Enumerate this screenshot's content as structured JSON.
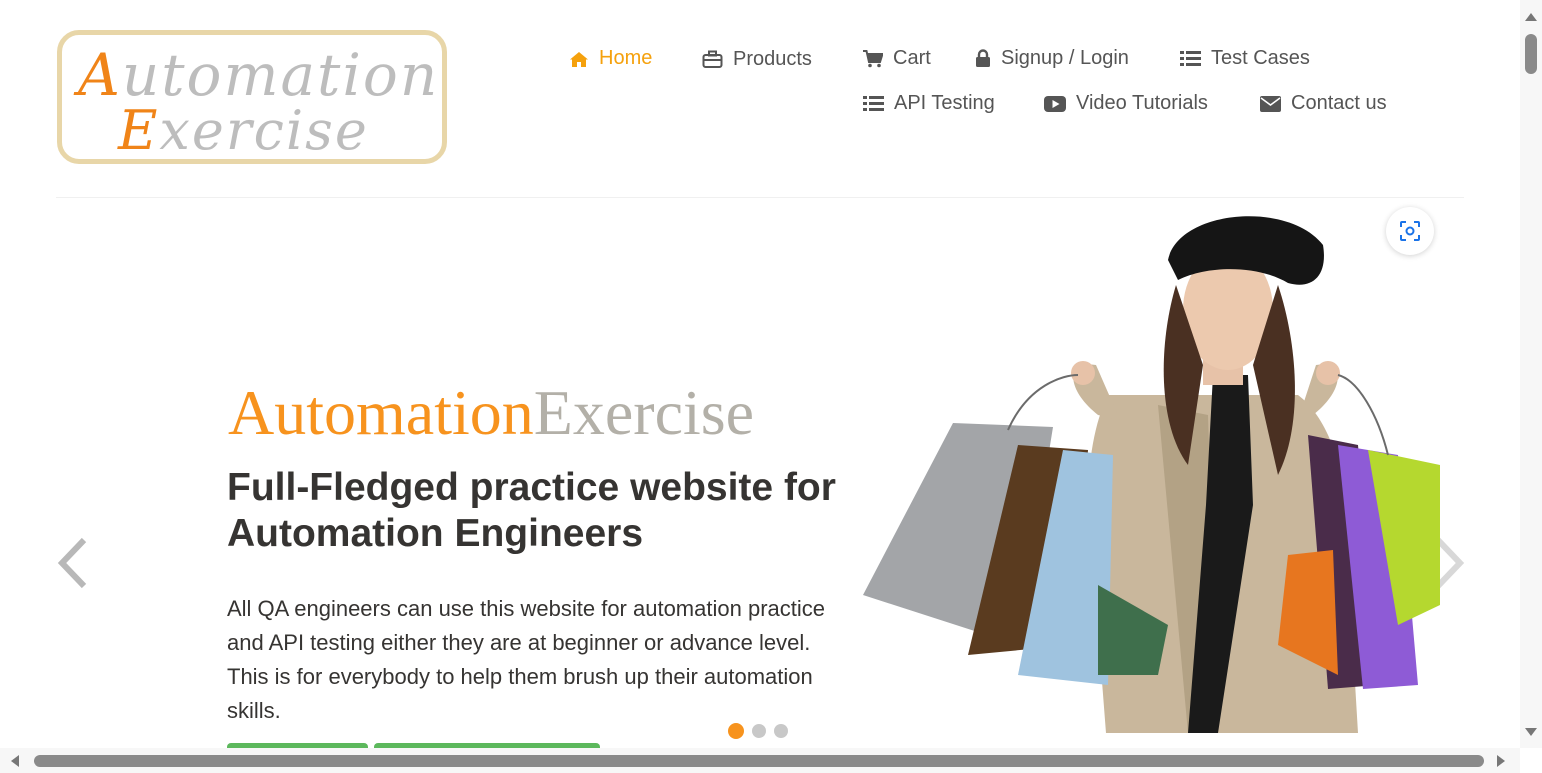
{
  "logo": {
    "line1": "Automation",
    "line2": "Exercise"
  },
  "nav": {
    "items": [
      {
        "label": "Home",
        "icon": "home-icon"
      },
      {
        "label": "Products",
        "icon": "briefcase-icon"
      },
      {
        "label": "Cart",
        "icon": "cart-icon"
      },
      {
        "label": "Signup / Login",
        "icon": "lock-icon"
      },
      {
        "label": "Test Cases",
        "icon": "list-icon"
      },
      {
        "label": "API Testing",
        "icon": "list-icon"
      },
      {
        "label": "Video Tutorials",
        "icon": "youtube-play-icon"
      },
      {
        "label": "Contact us",
        "icon": "envelope-icon"
      }
    ],
    "active": "Home"
  },
  "slider": {
    "brand_part1": "Automation",
    "brand_part2": "Exercise",
    "headline": "Full-Fledged practice website for Automation Engineers",
    "description": "All QA engineers can use this website for automation practice and API testing either they are at beginner or advance level. This is for everybody to help them brush up their automation skills.",
    "active_slide": 1,
    "slide_count": 3
  },
  "colors": {
    "accent_orange": "#f7931e",
    "nav_active": "#f5a10d",
    "brand_grey": "#b3b0a8",
    "button_green": "#5cb85c"
  }
}
